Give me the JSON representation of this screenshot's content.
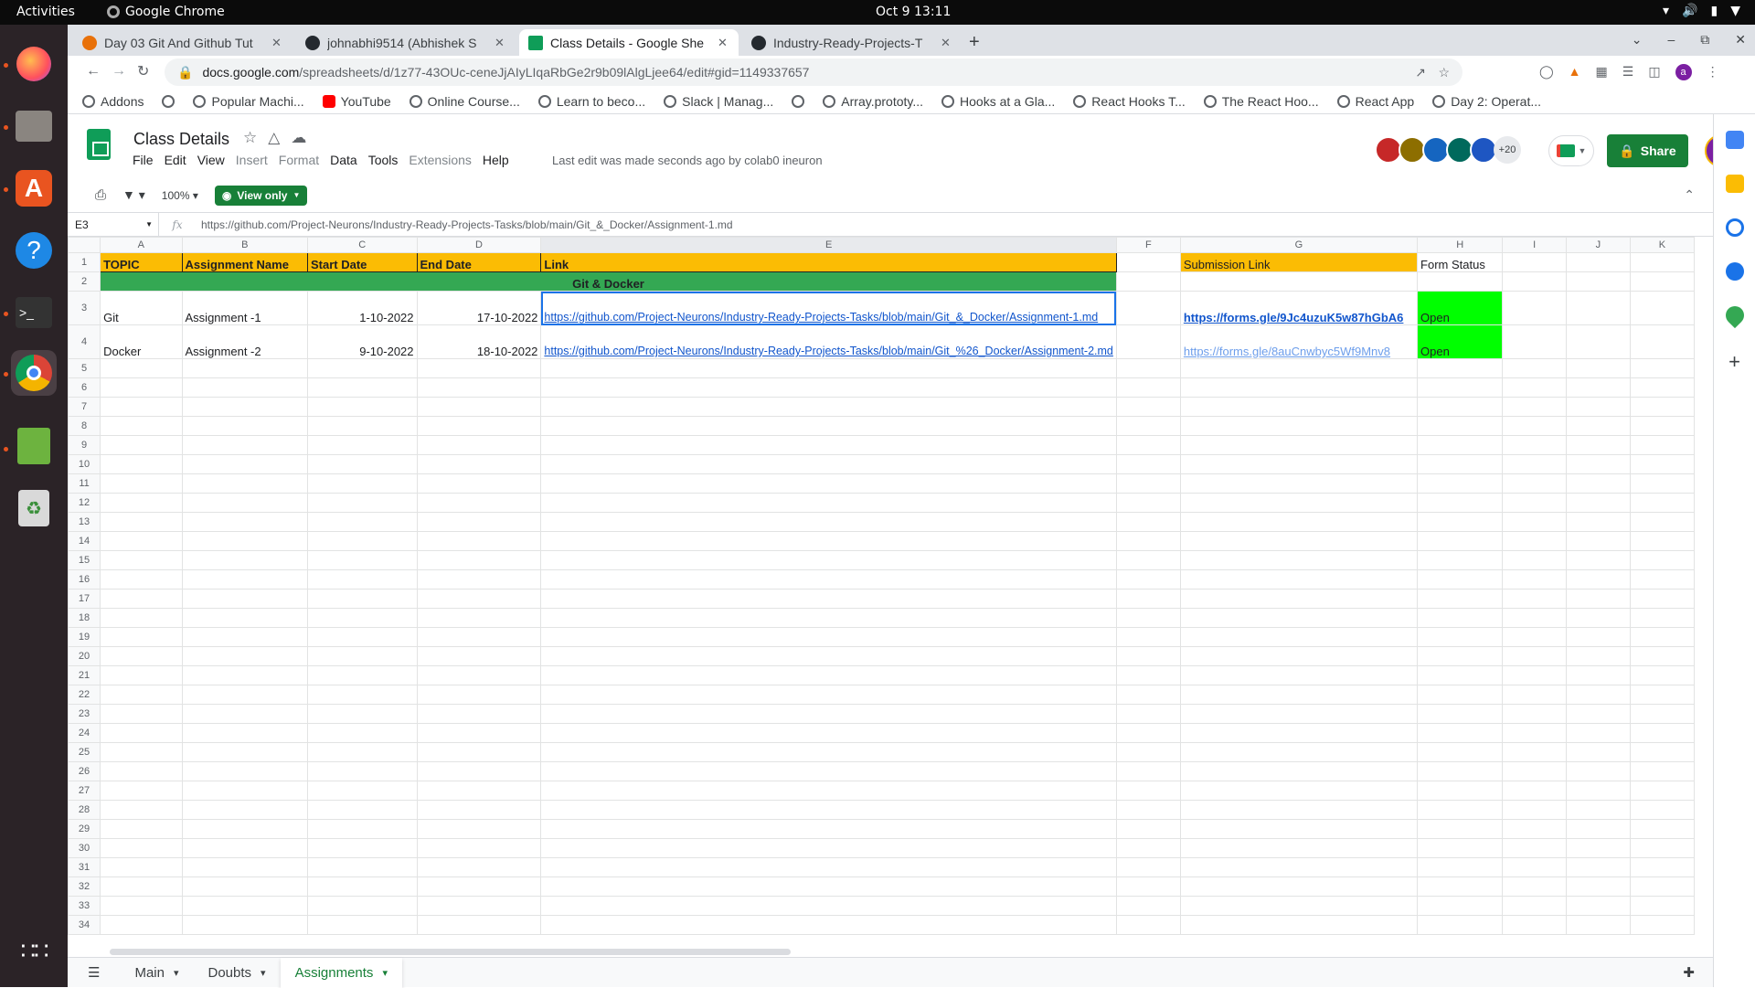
{
  "system": {
    "activities": "Activities",
    "app_name": "Google Chrome",
    "clock": "Oct 9  13:11"
  },
  "browser": {
    "tabs": [
      {
        "title": "Day 03 Git And Github Tut",
        "color": "#e8710a"
      },
      {
        "title": "johnabhi9514 (Abhishek S",
        "color": "#24292f"
      },
      {
        "title": "Class Details - Google She",
        "color": "#0f9d58"
      },
      {
        "title": "Industry-Ready-Projects-T",
        "color": "#24292f"
      }
    ],
    "new_tab": "+",
    "url_domain": "docs.google.com",
    "url_path": "/spreadsheets/d/1z77-43OUc-ceneJjAIyLIqaRbGe2r9b09lAlgLjee64/edit#gid=1149337657",
    "bookmarks": [
      "Addons",
      "",
      "Popular Machi...",
      "YouTube",
      "Online Course...",
      "Learn to beco...",
      "Slack | Manag...",
      "",
      "Array.prototy...",
      "Hooks at a Gla...",
      "React Hooks T...",
      "The React Hoo...",
      "React App",
      "Day 2: Operat..."
    ]
  },
  "sheets": {
    "doc_title": "Class Details",
    "menu": [
      {
        "label": "File",
        "disabled": false
      },
      {
        "label": "Edit",
        "disabled": false
      },
      {
        "label": "View",
        "disabled": false
      },
      {
        "label": "Insert",
        "disabled": true
      },
      {
        "label": "Format",
        "disabled": true
      },
      {
        "label": "Data",
        "disabled": false
      },
      {
        "label": "Tools",
        "disabled": false
      },
      {
        "label": "Extensions",
        "disabled": true
      },
      {
        "label": "Help",
        "disabled": false
      }
    ],
    "last_edit": "Last edit was made seconds ago by colab0 ineuron",
    "collaborator_count": "+20",
    "share_label": "Share",
    "me_initial": "a",
    "zoom": "100%",
    "view_only": "View only",
    "name_box": "E3",
    "formula": "https://github.com/Project-Neurons/Industry-Ready-Projects-Tasks/blob/main/Git_&_Docker/Assignment-1.md",
    "columns": [
      "A",
      "B",
      "C",
      "D",
      "E",
      "F",
      "G",
      "H",
      "I",
      "J",
      "K"
    ],
    "header_row": {
      "A": "TOPIC",
      "B": "Assignment Name",
      "C": "Start Date",
      "D": "End Date",
      "E": "Link",
      "G": "Submission Link",
      "H": "Form Status"
    },
    "band_row": "Git & Docker",
    "rows": [
      {
        "A": "Git",
        "B": "Assignment -1",
        "C": "1-10-2022",
        "D": "17-10-2022",
        "E": "https://github.com/Project-Neurons/Industry-Ready-Projects-Tasks/blob/main/Git_&_Docker/Assignment-1.md",
        "G": "https://forms.gle/9Jc4uzuK5w87hGbA6",
        "H": "Open"
      },
      {
        "A": "Docker",
        "B": "Assignment -2",
        "C": "9-10-2022",
        "D": "18-10-2022",
        "E": "https://github.com/Project-Neurons/Industry-Ready-Projects-Tasks/blob/main/Git_%26_Docker/Assignment-2.md",
        "G": "https://forms.gle/8auCnwbyc5Wf9Mnv8",
        "H": "Open"
      }
    ],
    "empty_row_count": 30,
    "sheet_tabs": [
      {
        "label": "Main",
        "active": false
      },
      {
        "label": "Doubts",
        "active": false
      },
      {
        "label": "Assignments",
        "active": true
      }
    ]
  }
}
